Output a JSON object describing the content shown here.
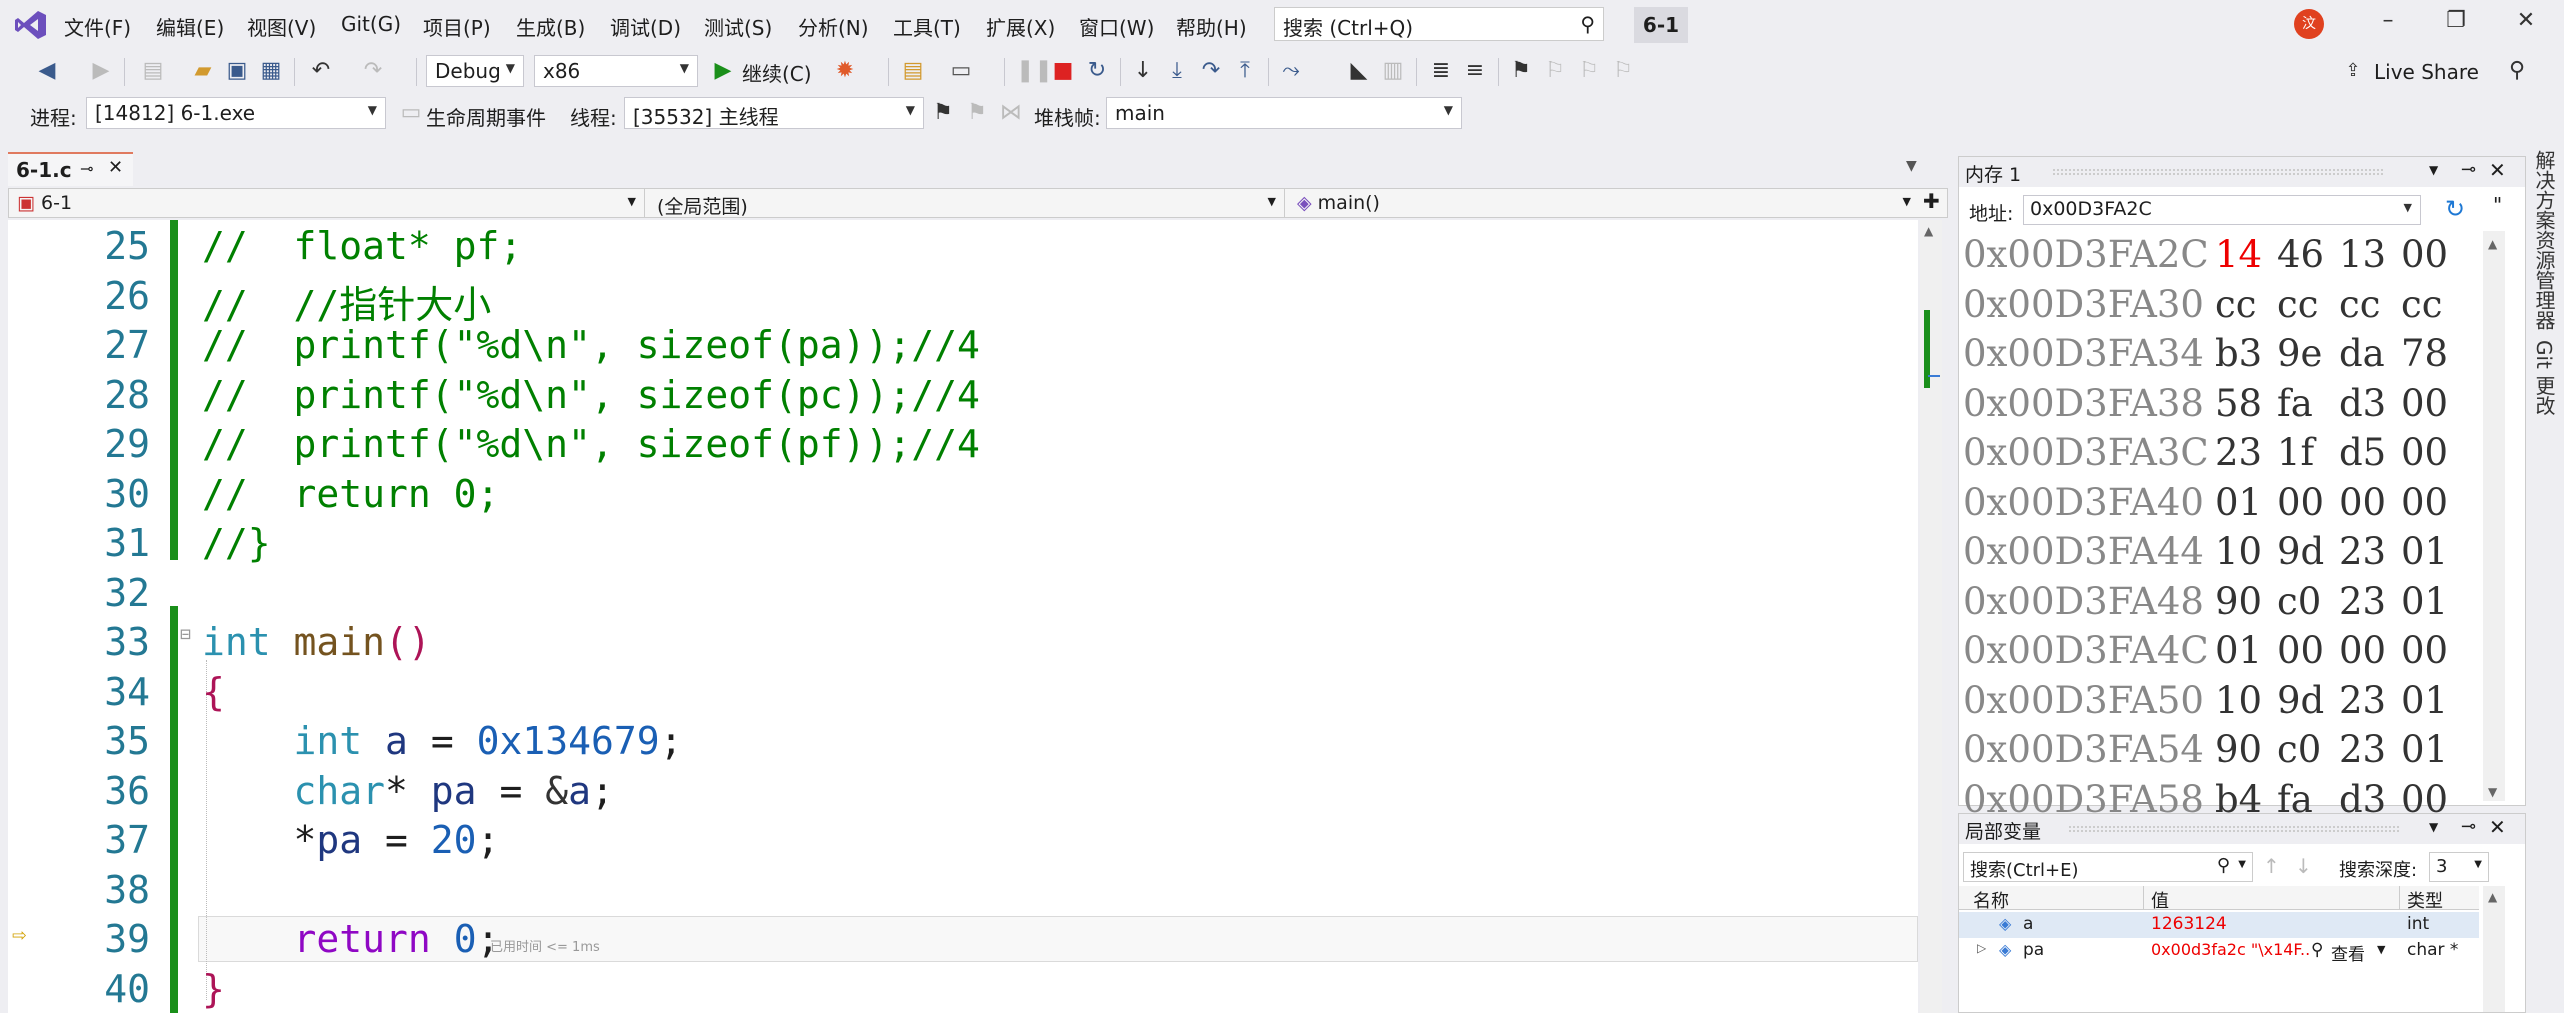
{
  "menu": [
    "文件(F)",
    "编辑(E)",
    "视图(V)",
    "Git(G)",
    "项目(P)",
    "生成(B)",
    "调试(D)",
    "测试(S)",
    "分析(N)",
    "工具(T)",
    "扩展(X)",
    "窗口(W)",
    "帮助(H)"
  ],
  "search": {
    "placeholder": "搜索 (Ctrl+Q)"
  },
  "project_name": "6-1",
  "avatar_initial": "汶",
  "toolbar": {
    "config": "Debug",
    "platform": "x86",
    "continue_label": "继续(C)",
    "live_share": "Live Share"
  },
  "debugbar": {
    "process_label": "进程:",
    "process_value": "[14812] 6-1.exe",
    "lifecycle_label": "生命周期事件",
    "thread_label": "线程:",
    "thread_value": "[35532] 主线程",
    "stackframe_label": "堆栈帧:",
    "stackframe_value": "main"
  },
  "doc_tab": {
    "name": "6-1.c"
  },
  "navbar": {
    "project": "6-1",
    "scope": "(全局范围)",
    "member": "main()"
  },
  "editor": {
    "lines": [
      {
        "n": "25",
        "text": "//  float* pf;"
      },
      {
        "n": "26",
        "text": "//  //指针大小"
      },
      {
        "n": "27",
        "text": "//  printf(\"%d\\n\", sizeof(pa));//4"
      },
      {
        "n": "28",
        "text": "//  printf(\"%d\\n\", sizeof(pc));//4"
      },
      {
        "n": "29",
        "text": "//  printf(\"%d\\n\", sizeof(pf));//4"
      },
      {
        "n": "30",
        "text": "//  return 0;"
      },
      {
        "n": "31",
        "text": "//}"
      },
      {
        "n": "32",
        "text": ""
      },
      {
        "n": "33",
        "text": "int main()"
      },
      {
        "n": "34",
        "text": "{"
      },
      {
        "n": "35",
        "text": "    int a = 0x134679;"
      },
      {
        "n": "36",
        "text": "    char* pa = &a;"
      },
      {
        "n": "37",
        "text": "    *pa = 20;"
      },
      {
        "n": "38",
        "text": ""
      },
      {
        "n": "39",
        "text": "    return 0;"
      },
      {
        "n": "40",
        "text": "}"
      }
    ],
    "elapsed_hint": "已用时间 <= 1ms"
  },
  "memory": {
    "title": "内存 1",
    "address_label": "地址:",
    "address_value": "0x00D3FA2C",
    "rows": [
      {
        "addr": "0x00D3FA2C",
        "bytes": [
          "14",
          "46",
          "13",
          "00"
        ],
        "changed": [
          true,
          false,
          false,
          false
        ]
      },
      {
        "addr": "0x00D3FA30",
        "bytes": [
          "cc",
          "cc",
          "cc",
          "cc"
        ],
        "changed": [
          false,
          false,
          false,
          false
        ]
      },
      {
        "addr": "0x00D3FA34",
        "bytes": [
          "b3",
          "9e",
          "da",
          "78"
        ],
        "changed": [
          false,
          false,
          false,
          false
        ]
      },
      {
        "addr": "0x00D3FA38",
        "bytes": [
          "58",
          "fa",
          "d3",
          "00"
        ],
        "changed": [
          false,
          false,
          false,
          false
        ]
      },
      {
        "addr": "0x00D3FA3C",
        "bytes": [
          "23",
          "1f",
          "d5",
          "00"
        ],
        "changed": [
          false,
          false,
          false,
          false
        ]
      },
      {
        "addr": "0x00D3FA40",
        "bytes": [
          "01",
          "00",
          "00",
          "00"
        ],
        "changed": [
          false,
          false,
          false,
          false
        ]
      },
      {
        "addr": "0x00D3FA44",
        "bytes": [
          "10",
          "9d",
          "23",
          "01"
        ],
        "changed": [
          false,
          false,
          false,
          false
        ]
      },
      {
        "addr": "0x00D3FA48",
        "bytes": [
          "90",
          "c0",
          "23",
          "01"
        ],
        "changed": [
          false,
          false,
          false,
          false
        ]
      },
      {
        "addr": "0x00D3FA4C",
        "bytes": [
          "01",
          "00",
          "00",
          "00"
        ],
        "changed": [
          false,
          false,
          false,
          false
        ]
      },
      {
        "addr": "0x00D3FA50",
        "bytes": [
          "10",
          "9d",
          "23",
          "01"
        ],
        "changed": [
          false,
          false,
          false,
          false
        ]
      },
      {
        "addr": "0x00D3FA54",
        "bytes": [
          "90",
          "c0",
          "23",
          "01"
        ],
        "changed": [
          false,
          false,
          false,
          false
        ]
      },
      {
        "addr": "0x00D3FA58",
        "bytes": [
          "b4",
          "fa",
          "d3",
          "00"
        ],
        "changed": [
          false,
          false,
          false,
          false
        ]
      }
    ]
  },
  "locals": {
    "title": "局部变量",
    "search_placeholder": "搜索(Ctrl+E)",
    "depth_label": "搜索深度:",
    "depth_value": "3",
    "columns": [
      "名称",
      "值",
      "类型"
    ],
    "rows": [
      {
        "name": "a",
        "value": "1263124",
        "type": "int"
      },
      {
        "name": "pa",
        "value": "0x00d3fa2c \"\\x14F...",
        "view": "查看",
        "type": "char *"
      }
    ]
  },
  "side_tabs": [
    "解决方案资源管理器",
    "Git 更改"
  ]
}
